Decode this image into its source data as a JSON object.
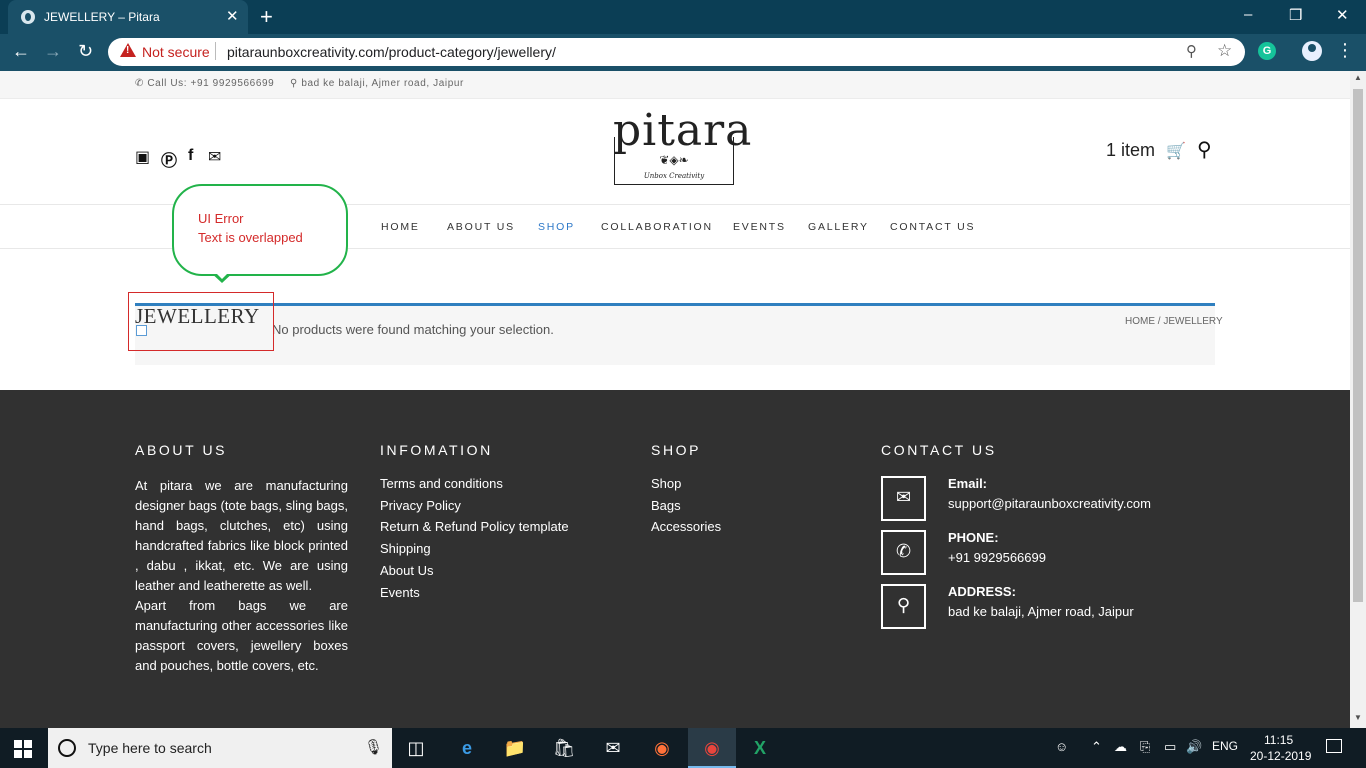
{
  "browser": {
    "tab_title": "JEWELLERY – Pitara",
    "tab_close": "✕",
    "new_tab": "+",
    "security_label": "Not secure",
    "url": "pitaraunboxcreativity.com/product-category/jewellery/",
    "window_controls": [
      "–",
      "❒",
      "✕"
    ],
    "extension_letter": "G"
  },
  "topbar": {
    "phone": "Call Us: +91 9929566699",
    "address": "bad ke balaji, Ajmer road, Jaipur"
  },
  "header": {
    "logo_text": "pitara",
    "logo_tagline": "Unbox Creativity",
    "cart_label": "1 item",
    "social_icons": [
      "instagram-icon",
      "pinterest-icon",
      "facebook-icon",
      "mail-icon"
    ]
  },
  "nav": {
    "items": [
      "HOME",
      "ABOUT US",
      "SHOP",
      "COLLABORATION",
      "EVENTS",
      "GALLERY",
      "CONTACT US"
    ],
    "active": "SHOP"
  },
  "annotation": {
    "line1": "UI Error",
    "line2": "Text is overlapped",
    "accent_color": "#22b34a",
    "error_color": "#d42a2a"
  },
  "content": {
    "page_title": "JEWELLERY",
    "notice": "No products were found matching your selection.",
    "breadcrumb": "HOME / JEWELLERY"
  },
  "footer": {
    "about": {
      "heading": "ABOUT US",
      "text": "At pitara we are manufacturing designer bags (tote bags, sling bags, hand bags, clutches, etc) using handcrafted fabrics like block printed , dabu , ikkat, etc. We are using leather and leatherette as well.",
      "text2": "Apart from bags we are manufacturing other accessories like passport covers, jewellery boxes and pouches, bottle covers, etc."
    },
    "info": {
      "heading": "INFOMATION",
      "links": [
        "Terms and conditions",
        "Privacy Policy",
        "Return & Refund Policy template",
        "Shipping",
        "About Us",
        "Events"
      ]
    },
    "shop": {
      "heading": "SHOP",
      "links": [
        "Shop",
        "Bags",
        "Accessories"
      ]
    },
    "contact": {
      "heading": "CONTACT US",
      "email_label": "Email:",
      "email": "support@pitaraunboxcreativity.com",
      "phone_label": "PHONE:",
      "phone": "+91 9929566699",
      "address_label": "ADDRESS:",
      "address": "bad ke balaji, Ajmer road, Jaipur"
    }
  },
  "taskbar": {
    "search_placeholder": "Type here to search",
    "language": "ENG",
    "time": "11:15",
    "date": "20-12-2019"
  },
  "colors": {
    "brand_blue": "#2d78c8",
    "footer_bg": "#313131",
    "chrome_dark": "#0b3e55"
  }
}
